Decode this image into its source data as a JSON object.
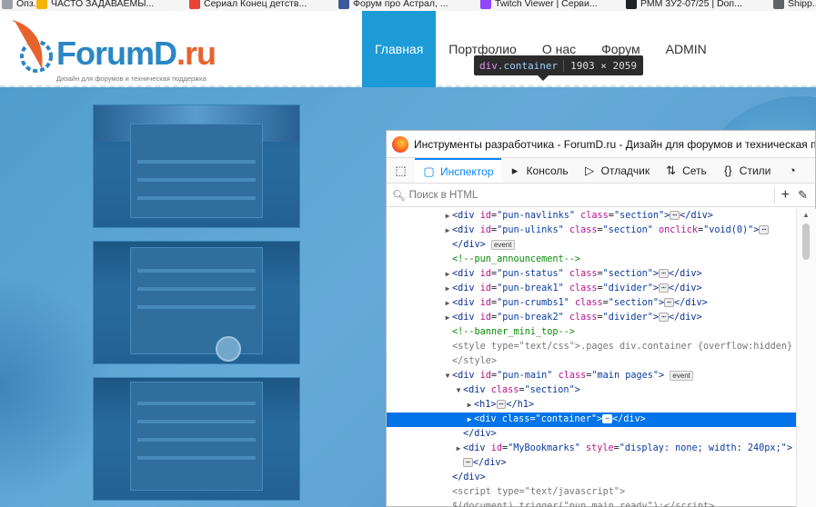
{
  "bookmarks": [
    {
      "label": "Опз...",
      "color": "#9aa0a6"
    },
    {
      "label": "ЧАСТО ЗАДАВАЕМЫ...",
      "color": "#f4b400"
    },
    {
      "label": "Сериал Конец детств...",
      "color": "#ea4335"
    },
    {
      "label": "Форум про Астрал, ...",
      "color": "#3b5998"
    },
    {
      "label": "Twitch Viewer | Серви...",
      "color": "#9146ff"
    },
    {
      "label": "РММ 3У2-07/25 | Dоп...",
      "color": "#202124"
    },
    {
      "label": "Shipp...",
      "color": "#5f6368"
    }
  ],
  "site": {
    "logo_main": "ForumD",
    "logo_dot": ".ru",
    "logo_tagline": "Дизайн для форумов и техническая поддержка",
    "nav": [
      {
        "label": "Главная",
        "active": true
      },
      {
        "label": "Портфолио",
        "active": false
      },
      {
        "label": "О нас",
        "active": false
      },
      {
        "label": "Форум",
        "active": false
      },
      {
        "label": "ADMIN",
        "active": false
      }
    ],
    "accent": "#1c9bd7"
  },
  "tooltip": {
    "tag": "div",
    "cls": ".container",
    "dims": "1903 × 2059"
  },
  "devtools": {
    "title": "Инструменты разработчика - ForumD.ru - Дизайн для форумов и техническая по",
    "tabs": [
      {
        "label": "",
        "icon": "pick-element-icon",
        "glyph": "⬚",
        "active": false
      },
      {
        "label": "Инспектор",
        "icon": "inspector-icon",
        "glyph": "▢",
        "active": true
      },
      {
        "label": "Консоль",
        "icon": "console-icon",
        "glyph": "▸",
        "active": false
      },
      {
        "label": "Отладчик",
        "icon": "debugger-icon",
        "glyph": "▷",
        "active": false
      },
      {
        "label": "Сеть",
        "icon": "network-icon",
        "glyph": "⇅",
        "active": false
      },
      {
        "label": "Стили",
        "icon": "style-editor-icon",
        "glyph": "{}",
        "active": false
      },
      {
        "label": "",
        "icon": "performance-icon",
        "glyph": "◔",
        "active": false
      }
    ],
    "search_placeholder": "Поиск в HTML",
    "tree": [
      {
        "indent": 0,
        "tw": "▶",
        "html": "<span class='tag'>&lt;div</span> <span class='an'>id</span>=<span class='av'>\"pun-navlinks\"</span> <span class='an'>class</span>=<span class='av'>\"section\"</span><span class='tag'>&gt;</span><span class='ell'>⋯</span><span class='tag'>&lt;/div&gt;</span>"
      },
      {
        "indent": 0,
        "tw": "▶",
        "html": "<span class='tag'>&lt;div</span> <span class='an'>id</span>=<span class='av'>\"pun-ulinks\"</span> <span class='an'>class</span>=<span class='av'>\"section\"</span> <span class='an'>onclick</span>=<span class='av'>\"void(0)\"</span><span class='tag'>&gt;</span><span class='ell'>⋯</span>"
      },
      {
        "indent": 0,
        "tw": "",
        "html": "<span class='tag'>&lt;/div&gt;</span> <span class='badge'>event</span>"
      },
      {
        "indent": 0,
        "tw": "",
        "html": "<span class='cm'>&lt;!--pun_announcement--&gt;</span>"
      },
      {
        "indent": 0,
        "tw": "▶",
        "html": "<span class='tag'>&lt;div</span> <span class='an'>id</span>=<span class='av'>\"pun-status\"</span> <span class='an'>class</span>=<span class='av'>\"section\"</span><span class='tag'>&gt;</span><span class='ell'>⋯</span><span class='tag'>&lt;/div&gt;</span>"
      },
      {
        "indent": 0,
        "tw": "▶",
        "html": "<span class='tag'>&lt;div</span> <span class='an'>id</span>=<span class='av'>\"pun-break1\"</span> <span class='an'>class</span>=<span class='av'>\"divider\"</span><span class='tag'>&gt;</span><span class='ell'>⋯</span><span class='tag'>&lt;/div&gt;</span>"
      },
      {
        "indent": 0,
        "tw": "▶",
        "html": "<span class='tag'>&lt;div</span> <span class='an'>id</span>=<span class='av'>\"pun-crumbs1\"</span> <span class='an'>class</span>=<span class='av'>\"section\"</span><span class='tag'>&gt;</span><span class='ell'>⋯</span><span class='tag'>&lt;/div&gt;</span>"
      },
      {
        "indent": 0,
        "tw": "▶",
        "html": "<span class='tag'>&lt;div</span> <span class='an'>id</span>=<span class='av'>\"pun-break2\"</span> <span class='an'>class</span>=<span class='av'>\"divider\"</span><span class='tag'>&gt;</span><span class='ell'>⋯</span><span class='tag'>&lt;/div&gt;</span>"
      },
      {
        "indent": 0,
        "tw": "",
        "html": "<span class='cm'>&lt;!--banner_mini_top--&gt;</span>"
      },
      {
        "indent": 0,
        "tw": "",
        "html": "<span class='st'>&lt;style type=\"text/css\"&gt;.pages div.container {overflow:hidden}</span>"
      },
      {
        "indent": 0,
        "tw": "",
        "html": "<span class='st'>&lt;/style&gt;</span>"
      },
      {
        "indent": 0,
        "tw": "▼",
        "html": "<span class='tag'>&lt;div</span> <span class='an'>id</span>=<span class='av'>\"pun-main\"</span> <span class='an'>class</span>=<span class='av'>\"main pages\"</span><span class='tag'>&gt;</span> <span class='badge'>event</span>"
      },
      {
        "indent": 1,
        "tw": "▼",
        "html": "<span class='tag'>&lt;div</span> <span class='an'>class</span>=<span class='av'>\"section\"</span><span class='tag'>&gt;</span>"
      },
      {
        "indent": 2,
        "tw": "▶",
        "html": "<span class='tag'>&lt;h1&gt;</span><span class='ell'>⋯</span><span class='tag'>&lt;/h1&gt;</span>"
      },
      {
        "indent": 2,
        "tw": "▶",
        "selected": true,
        "html": "<span class='tag'>&lt;div</span> <span class='an'>class</span>=<span class='av'>\"container\"</span><span class='tag'>&gt;</span><span class='ell'>⋯</span><span class='tag'>&lt;/div&gt;</span>"
      },
      {
        "indent": 1,
        "tw": "",
        "html": "<span class='tag'>&lt;/div&gt;</span>"
      },
      {
        "indent": 1,
        "tw": "▶",
        "html": "<span class='tag'>&lt;div</span> <span class='an'>id</span>=<span class='av'>\"MyBookmarks\"</span> <span class='an'>style</span>=<span class='av'>\"display: none; width: 240px;\"</span><span class='tag'>&gt;</span>"
      },
      {
        "indent": 1,
        "tw": "",
        "html": "<span class='ell'>⋯</span><span class='tag'>&lt;/div&gt;</span>"
      },
      {
        "indent": 0,
        "tw": "",
        "html": "<span class='tag'>&lt;/div&gt;</span>"
      },
      {
        "indent": 0,
        "tw": "",
        "html": "<span class='st'>&lt;script type=\"text/javascript\"&gt;</span>"
      },
      {
        "indent": 0,
        "tw": "",
        "html": "<span class='st'>$(document).trigger(\"pun_main_ready\");&lt;/script&gt;</span>"
      }
    ]
  }
}
